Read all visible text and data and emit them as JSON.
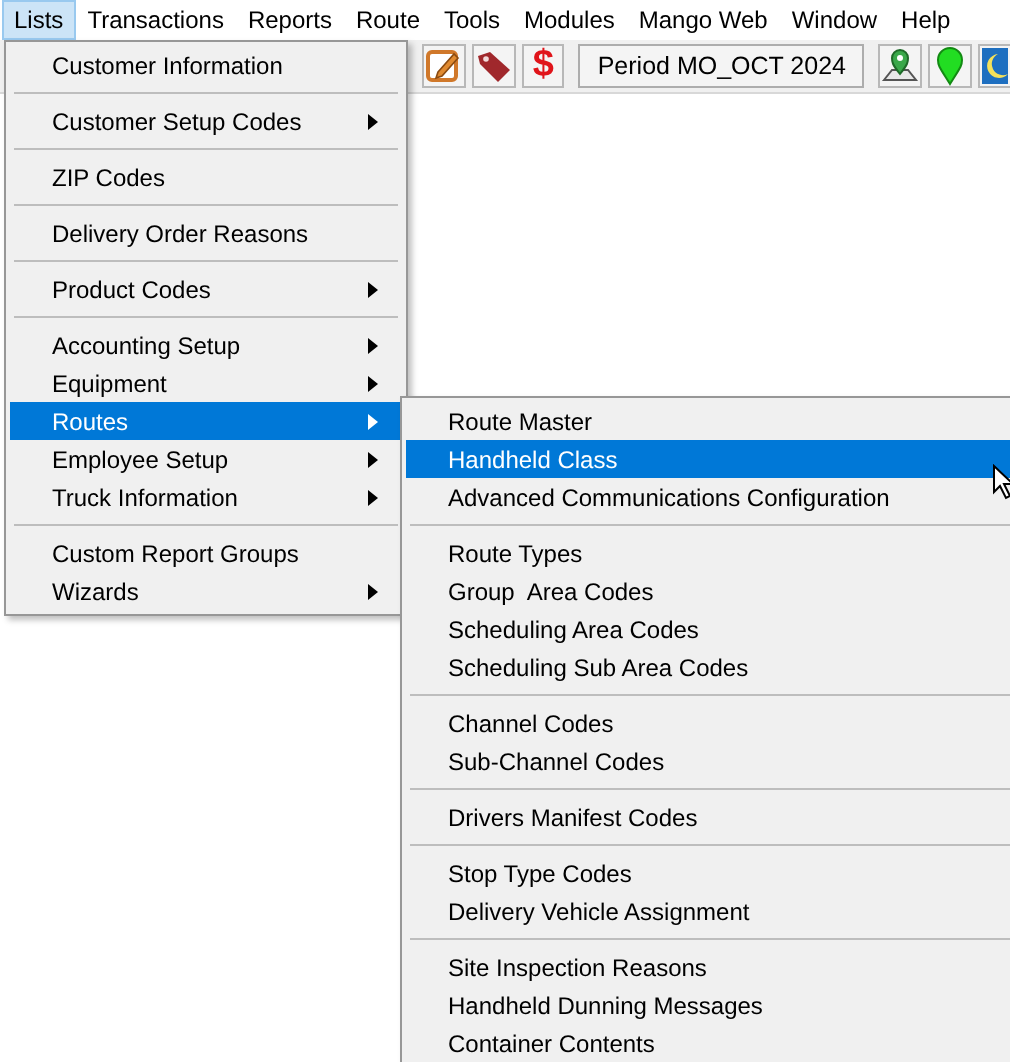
{
  "menubar": [
    {
      "label": "Lists",
      "selected": true
    },
    {
      "label": "Transactions",
      "selected": false
    },
    {
      "label": "Reports",
      "selected": false
    },
    {
      "label": "Route",
      "selected": false
    },
    {
      "label": "Tools",
      "selected": false
    },
    {
      "label": "Modules",
      "selected": false
    },
    {
      "label": "Mango Web",
      "selected": false
    },
    {
      "label": "Window",
      "selected": false
    },
    {
      "label": "Help",
      "selected": false
    }
  ],
  "toolbar": {
    "currency_symbol": "$",
    "period_button": "Period MO_OCT  2024"
  },
  "lists_menu": [
    {
      "kind": "item",
      "label": "Customer Information",
      "submenu": false,
      "selected": false
    },
    {
      "kind": "separator"
    },
    {
      "kind": "item",
      "label": "Customer Setup Codes",
      "submenu": true,
      "selected": false
    },
    {
      "kind": "separator"
    },
    {
      "kind": "item",
      "label": "ZIP Codes",
      "submenu": false,
      "selected": false
    },
    {
      "kind": "separator"
    },
    {
      "kind": "item",
      "label": "Delivery Order Reasons",
      "submenu": false,
      "selected": false
    },
    {
      "kind": "separator"
    },
    {
      "kind": "item",
      "label": "Product Codes",
      "submenu": true,
      "selected": false
    },
    {
      "kind": "separator"
    },
    {
      "kind": "item",
      "label": "Accounting Setup",
      "submenu": true,
      "selected": false
    },
    {
      "kind": "item",
      "label": "Equipment",
      "submenu": true,
      "selected": false
    },
    {
      "kind": "item",
      "label": "Routes",
      "submenu": true,
      "selected": true
    },
    {
      "kind": "item",
      "label": "Employee Setup",
      "submenu": true,
      "selected": false
    },
    {
      "kind": "item",
      "label": "Truck Information",
      "submenu": true,
      "selected": false
    },
    {
      "kind": "separator"
    },
    {
      "kind": "item",
      "label": "Custom Report Groups",
      "submenu": false,
      "selected": false
    },
    {
      "kind": "item",
      "label": "Wizards",
      "submenu": true,
      "selected": false
    }
  ],
  "routes_submenu": [
    {
      "kind": "item",
      "label": "Route Master",
      "submenu": false,
      "selected": false
    },
    {
      "kind": "item",
      "label": "Handheld Class",
      "submenu": false,
      "selected": true
    },
    {
      "kind": "item",
      "label": "Advanced Communications Configuration",
      "submenu": false,
      "selected": false
    },
    {
      "kind": "separator"
    },
    {
      "kind": "item",
      "label": "Route Types",
      "submenu": false,
      "selected": false
    },
    {
      "kind": "item",
      "label": "Group  Area Codes",
      "submenu": false,
      "selected": false
    },
    {
      "kind": "item",
      "label": "Scheduling Area Codes",
      "submenu": false,
      "selected": false
    },
    {
      "kind": "item",
      "label": "Scheduling Sub Area Codes",
      "submenu": false,
      "selected": false
    },
    {
      "kind": "separator"
    },
    {
      "kind": "item",
      "label": "Channel Codes",
      "submenu": false,
      "selected": false
    },
    {
      "kind": "item",
      "label": "Sub-Channel Codes",
      "submenu": false,
      "selected": false
    },
    {
      "kind": "separator"
    },
    {
      "kind": "item",
      "label": "Drivers Manifest Codes",
      "submenu": false,
      "selected": false
    },
    {
      "kind": "separator"
    },
    {
      "kind": "item",
      "label": "Stop Type Codes",
      "submenu": false,
      "selected": false
    },
    {
      "kind": "item",
      "label": "Delivery Vehicle Assignment",
      "submenu": false,
      "selected": false
    },
    {
      "kind": "separator"
    },
    {
      "kind": "item",
      "label": "Site Inspection Reasons",
      "submenu": false,
      "selected": false
    },
    {
      "kind": "item",
      "label": "Handheld Dunning Messages",
      "submenu": false,
      "selected": false
    },
    {
      "kind": "item",
      "label": "Container Contents",
      "submenu": false,
      "selected": false
    }
  ]
}
